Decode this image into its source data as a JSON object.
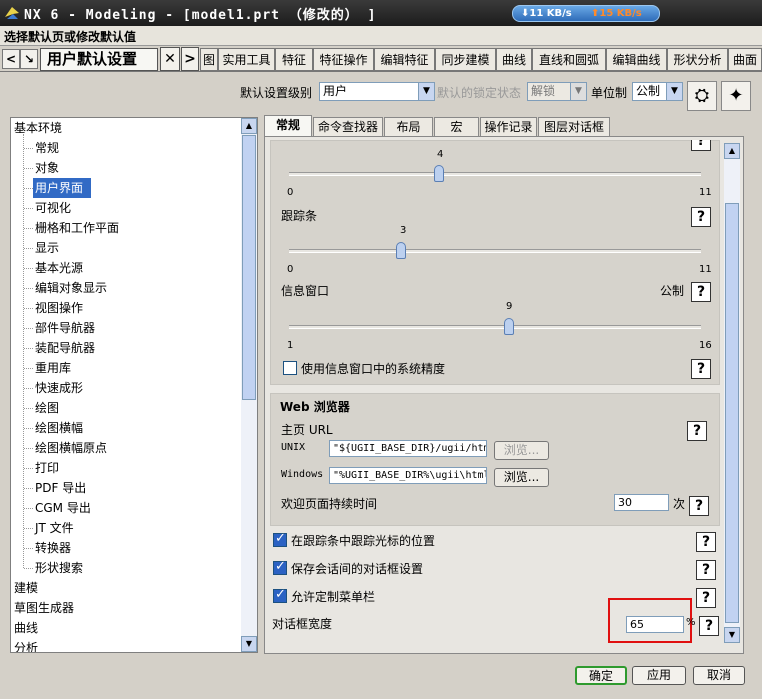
{
  "window": {
    "title": "NX 6 - Modeling - [model1.prt （修改的） ]",
    "download_speed": "11 KB/s",
    "upload_speed": "15 KB/s"
  },
  "dialog": {
    "header": "选择默认页或修改默认值"
  },
  "toolbar_tabs": {
    "active": "用户默认设置",
    "items": [
      "图",
      "实用工具",
      "特征",
      "特征操作",
      "编辑特征",
      "同步建模",
      "曲线",
      "直线和圆弧",
      "编辑曲线",
      "形状分析",
      "曲面"
    ]
  },
  "settings_row": {
    "level_label": "默认设置级别",
    "level_value": "用户",
    "lock_label": "默认的锁定状态",
    "lock_value": "解锁",
    "unit_label": "单位制",
    "unit_value": "公制"
  },
  "tree": {
    "items": [
      {
        "label": "基本环境",
        "child": false
      },
      {
        "label": "常规",
        "child": true
      },
      {
        "label": "对象",
        "child": true
      },
      {
        "label": "用户界面",
        "child": true,
        "selected": true
      },
      {
        "label": "可视化",
        "child": true
      },
      {
        "label": "栅格和工作平面",
        "child": true
      },
      {
        "label": "显示",
        "child": true
      },
      {
        "label": "基本光源",
        "child": true
      },
      {
        "label": "编辑对象显示",
        "child": true
      },
      {
        "label": "视图操作",
        "child": true
      },
      {
        "label": "部件导航器",
        "child": true
      },
      {
        "label": "装配导航器",
        "child": true
      },
      {
        "label": "重用库",
        "child": true
      },
      {
        "label": "快速成形",
        "child": true
      },
      {
        "label": "绘图",
        "child": true
      },
      {
        "label": "绘图横幅",
        "child": true
      },
      {
        "label": "绘图横幅原点",
        "child": true
      },
      {
        "label": "打印",
        "child": true
      },
      {
        "label": "PDF 导出",
        "child": true
      },
      {
        "label": "CGM 导出",
        "child": true
      },
      {
        "label": "JT 文件",
        "child": true
      },
      {
        "label": "转换器",
        "child": true
      },
      {
        "label": "形状搜索",
        "child": true
      },
      {
        "label": "建模",
        "child": false
      },
      {
        "label": "草图生成器",
        "child": false
      },
      {
        "label": "曲线",
        "child": false
      },
      {
        "label": "分析",
        "child": false
      }
    ]
  },
  "panel_tabs": [
    "常规",
    "命令查找器",
    "布局",
    "宏",
    "操作记录",
    "图层对话框"
  ],
  "sliders": {
    "s1": {
      "value": "4",
      "min": "0",
      "max": "11",
      "fraction": 0.3636
    },
    "tracker": {
      "label": "跟踪条",
      "value": "3",
      "min": "0",
      "max": "11",
      "fraction": 0.2727
    },
    "info_window": {
      "label": "信息窗口",
      "unit": "公制",
      "value": "9",
      "min": "1",
      "max": "16",
      "fraction": 0.5333
    }
  },
  "checkbox_sys_precision": {
    "label": "使用信息窗口中的系统精度",
    "checked": false
  },
  "web": {
    "title": "Web 浏览器",
    "home_label": "主页 URL",
    "unix_label": "UNIX",
    "unix_value": "\"${UGII_BASE_DIR}/ugii/htm",
    "windows_label": "Windows",
    "windows_value": "\"%UGII_BASE_DIR%\\ugii\\html",
    "browse": "浏览...",
    "welcome_label": "欢迎页面持续时间",
    "welcome_value": "30",
    "welcome_unit": "次"
  },
  "options": [
    {
      "label": "在跟踪条中跟踪光标的位置",
      "checked": true
    },
    {
      "label": "保存会话间的对话框设置",
      "checked": true
    },
    {
      "label": "允许定制菜单栏",
      "checked": true
    }
  ],
  "dialog_width": {
    "label": "对话框宽度",
    "value": "65",
    "unit": "%"
  },
  "help_glyph": "?",
  "buttons": {
    "ok": "确定",
    "apply": "应用",
    "cancel": "取消"
  }
}
